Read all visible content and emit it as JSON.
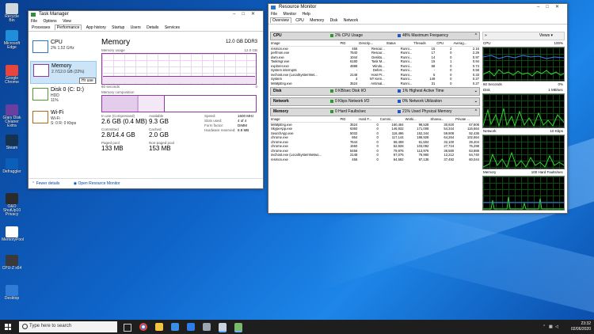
{
  "desktop": {
    "icons": [
      {
        "label": "Recycle Bin",
        "color": "#cfd8dc"
      },
      {
        "label": "Microsoft Edge",
        "color": "#1f8fdc"
      },
      {
        "label": "Google Chrome",
        "color": "#e8453c"
      },
      {
        "label": "Glary Disk Cleaner Extra",
        "color": "#6b3fa0"
      },
      {
        "label": "Steam",
        "color": "#17324f"
      },
      {
        "label": "Defraggler",
        "color": "#0b5fb8"
      },
      {
        "label": "O&O ShutUp10 Privacy",
        "color": "#2b2b2b"
      },
      {
        "label": "MemoryPool",
        "color": "#ffffff"
      },
      {
        "label": "CPU-Z x64",
        "color": "#3a3a3a"
      },
      {
        "label": "Desktop",
        "color": "#2f7cd6"
      }
    ]
  },
  "task_manager": {
    "title": "Task Manager",
    "menu": [
      "File",
      "Options",
      "View"
    ],
    "tabs": [
      "Processes",
      "Performance",
      "App history",
      "Startup",
      "Users",
      "Details",
      "Services"
    ],
    "selected_tab": "Performance",
    "perf_items": [
      {
        "name": "CPU",
        "line1": "2% 1.52 GHz",
        "line2": "",
        "color": "#1f7ad6"
      },
      {
        "name": "Memory",
        "line1": "2.7/12.0 GB (22%)",
        "line2": "",
        "color": "#8b3b9a"
      },
      {
        "name": "Disk 0 (C: D:)",
        "line1": "HDD",
        "line2": "11%",
        "color": "#4b9e2f"
      },
      {
        "name": "Wi-Fi",
        "line1": "Wi-Fi",
        "line2": "S: 0 R: 0 Kbps",
        "color": "#b16a1a"
      }
    ],
    "tooltip": "Hr use",
    "memory": {
      "title": "Memory",
      "capacity": "12.0 GB DDR3",
      "usage_label": "Memory usage",
      "usage_max": "12.0 GB",
      "seconds": "60 seconds",
      "zero": "0",
      "composition_label": "Memory composition",
      "usage_fraction": 0.22,
      "stats": [
        {
          "key": "In use (Compressed)",
          "value": "2.6 GB (0.4 MB)"
        },
        {
          "key": "Available",
          "value": "9.3 GB"
        },
        {
          "key": "Committed",
          "value": "2.8/14.4 GB"
        },
        {
          "key": "Cached",
          "value": "2.0 GB"
        },
        {
          "key": "Paged pool",
          "value": "133 MB"
        },
        {
          "key": "Non-paged pool",
          "value": "153 MB"
        }
      ],
      "right_stats": [
        {
          "key": "Speed:",
          "value": "1600 MHz"
        },
        {
          "key": "Slots used:",
          "value": "4 of 4"
        },
        {
          "key": "Form factor:",
          "value": "DIMM"
        },
        {
          "key": "Hardware reserved:",
          "value": "8.9 MB"
        }
      ]
    },
    "footer": {
      "fewer": "Fewer details",
      "open_rm": "Open Resource Monitor"
    }
  },
  "resource_monitor": {
    "title": "Resource Monitor",
    "menu": [
      "File",
      "Monitor",
      "Help"
    ],
    "tabs": [
      "Overview",
      "CPU",
      "Memory",
      "Disk",
      "Network"
    ],
    "cpu_section": {
      "title": "CPU",
      "usage": "2% CPU Usage",
      "freq": "48% Maximum Frequency"
    },
    "cpu_columns": [
      "Image",
      "PID",
      "Descrip...",
      "Status",
      "Threads",
      "CPU",
      "Averag..."
    ],
    "cpu_rows": [
      [
        "resmon.exe",
        "456",
        "Resour...",
        "Runni...",
        "15",
        "2",
        "2.16"
      ],
      [
        "perfmon.exe",
        "7640",
        "Resour...",
        "Runni...",
        "17",
        "0",
        "2.29"
      ],
      [
        "dwm.exe",
        "1044",
        "Deskto...",
        "Runni...",
        "14",
        "0",
        "0.97"
      ],
      [
        "Taskmgr.exe",
        "6180",
        "Task M...",
        "Runni...",
        "15",
        "1",
        "0.94"
      ],
      [
        "explorer.exe",
        "4888",
        "Windo...",
        "Runni...",
        "68",
        "0",
        "0.74"
      ],
      [
        "System interrupts",
        "-",
        "Deferr...",
        "Runni...",
        "-",
        "0",
        "0.58"
      ],
      [
        "svchost.exe (LocalSystemNet...",
        "2148",
        "Host Pr...",
        "Runni...",
        "5",
        "0",
        "0.33"
      ],
      [
        "System",
        "4",
        "NT Kern...",
        "Runni...",
        "149",
        "0",
        "0.27"
      ],
      [
        "MsMpEng.exe",
        "3524",
        "Antimal...",
        "Runni...",
        "31",
        "0",
        "0.27"
      ]
    ],
    "disk_section": {
      "title": "Disk",
      "usage": "0 KB/sec Disk I/O",
      "active": "1% Highest Active Time"
    },
    "net_section": {
      "title": "Network",
      "usage": "0 Kbps Network I/O",
      "active": "0% Network Utilization"
    },
    "mem_section": {
      "title": "Memory",
      "usage": "0 Hard Faults/sec",
      "active": "21% Used Physical Memory"
    },
    "mem_columns": [
      "Image",
      "PID",
      "Hard F...",
      "Commi...",
      "Worki...",
      "Sharea...",
      "Private ..."
    ],
    "mem_rows": [
      [
        "MsMpEng.exe",
        "3524",
        "0",
        "160,464",
        "98,528",
        "30,920",
        "67,608"
      ],
      [
        "SkypeApp.exe",
        "6360",
        "0",
        "146,932",
        "171,008",
        "54,344",
        "116,664"
      ],
      [
        "SearchApp.exe",
        "5032",
        "0",
        "118,496",
        "152,344",
        "59,908",
        "92,436"
      ],
      [
        "chrome.exe",
        "864",
        "0",
        "117,144",
        "186,928",
        "64,264",
        "102,664"
      ],
      [
        "chrome.exe",
        "7644",
        "0",
        "69,408",
        "61,504",
        "32,100",
        "29,404"
      ],
      [
        "chrome.exe",
        "1550",
        "0",
        "62,928",
        "103,092",
        "27,724",
        "75,298"
      ],
      [
        "chrome.exe",
        "5456",
        "0",
        "79,976",
        "113,976",
        "36,580",
        "63,888"
      ],
      [
        "svchost.exe (LocalSystemNetwo...",
        "2148",
        "0",
        "67,076",
        "76,960",
        "12,212",
        "64,740"
      ],
      [
        "resmon.exe",
        "456",
        "0",
        "64,592",
        "97,136",
        "37,492",
        "60,044"
      ]
    ],
    "views_label": "Views",
    "graphs": [
      {
        "name": "CPU",
        "right": "100%",
        "left_bottom": "60 Seconds",
        "right_bottom": "0%"
      },
      {
        "name": "Disk",
        "right": "1 MB/sec",
        "left_bottom": "",
        "right_bottom": ""
      },
      {
        "name": "Network",
        "right": "10 Kbps",
        "left_bottom": "",
        "right_bottom": ""
      },
      {
        "name": "Memory",
        "right": "100 Hard Faults/sec",
        "left_bottom": "",
        "right_bottom": ""
      }
    ],
    "colors": {
      "cpu_sq": "#2e9a2e",
      "freq_sq": "#1f57c7",
      "disk_sq": "#2e9a2e",
      "net_sq": "#2e9a2e",
      "mem_sq": "#2e9a2e"
    }
  },
  "taskbar": {
    "search_placeholder": "Type here to search",
    "apps": [
      "task-view-icon",
      "chrome-icon",
      "file-explorer-icon",
      "store-icon",
      "mail-icon",
      "photos-icon",
      "resource-monitor-icon",
      "task-manager-icon"
    ],
    "time": "23:32",
    "date": "02/06/2020"
  }
}
